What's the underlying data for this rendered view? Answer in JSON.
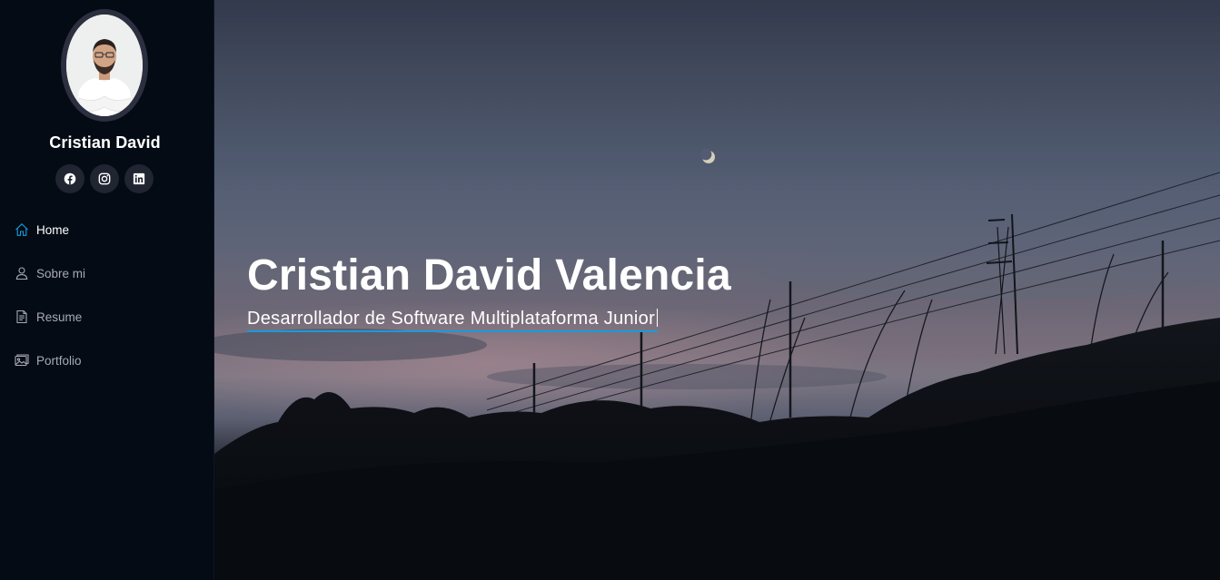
{
  "profile": {
    "name": "Cristian David",
    "avatar_icon": "profile-photo"
  },
  "social": [
    {
      "name": "facebook",
      "icon": "facebook-icon"
    },
    {
      "name": "instagram",
      "icon": "instagram-icon"
    },
    {
      "name": "linkedin",
      "icon": "linkedin-icon"
    }
  ],
  "nav": {
    "items": [
      {
        "label": "Home",
        "icon": "home-icon",
        "active": true
      },
      {
        "label": "Sobre mi",
        "icon": "person-icon",
        "active": false
      },
      {
        "label": "Resume",
        "icon": "file-text-icon",
        "active": false
      },
      {
        "label": "Portfolio",
        "icon": "images-icon",
        "active": false
      }
    ]
  },
  "hero": {
    "title": "Cristian David Valencia",
    "subtitle": "Desarrollador de Software Multiplataforma Junior"
  },
  "colors": {
    "accent": "#149ddd",
    "sidebar_bg": "#040b14",
    "social_bg": "#212431",
    "nav_text": "#a8a9b4"
  }
}
